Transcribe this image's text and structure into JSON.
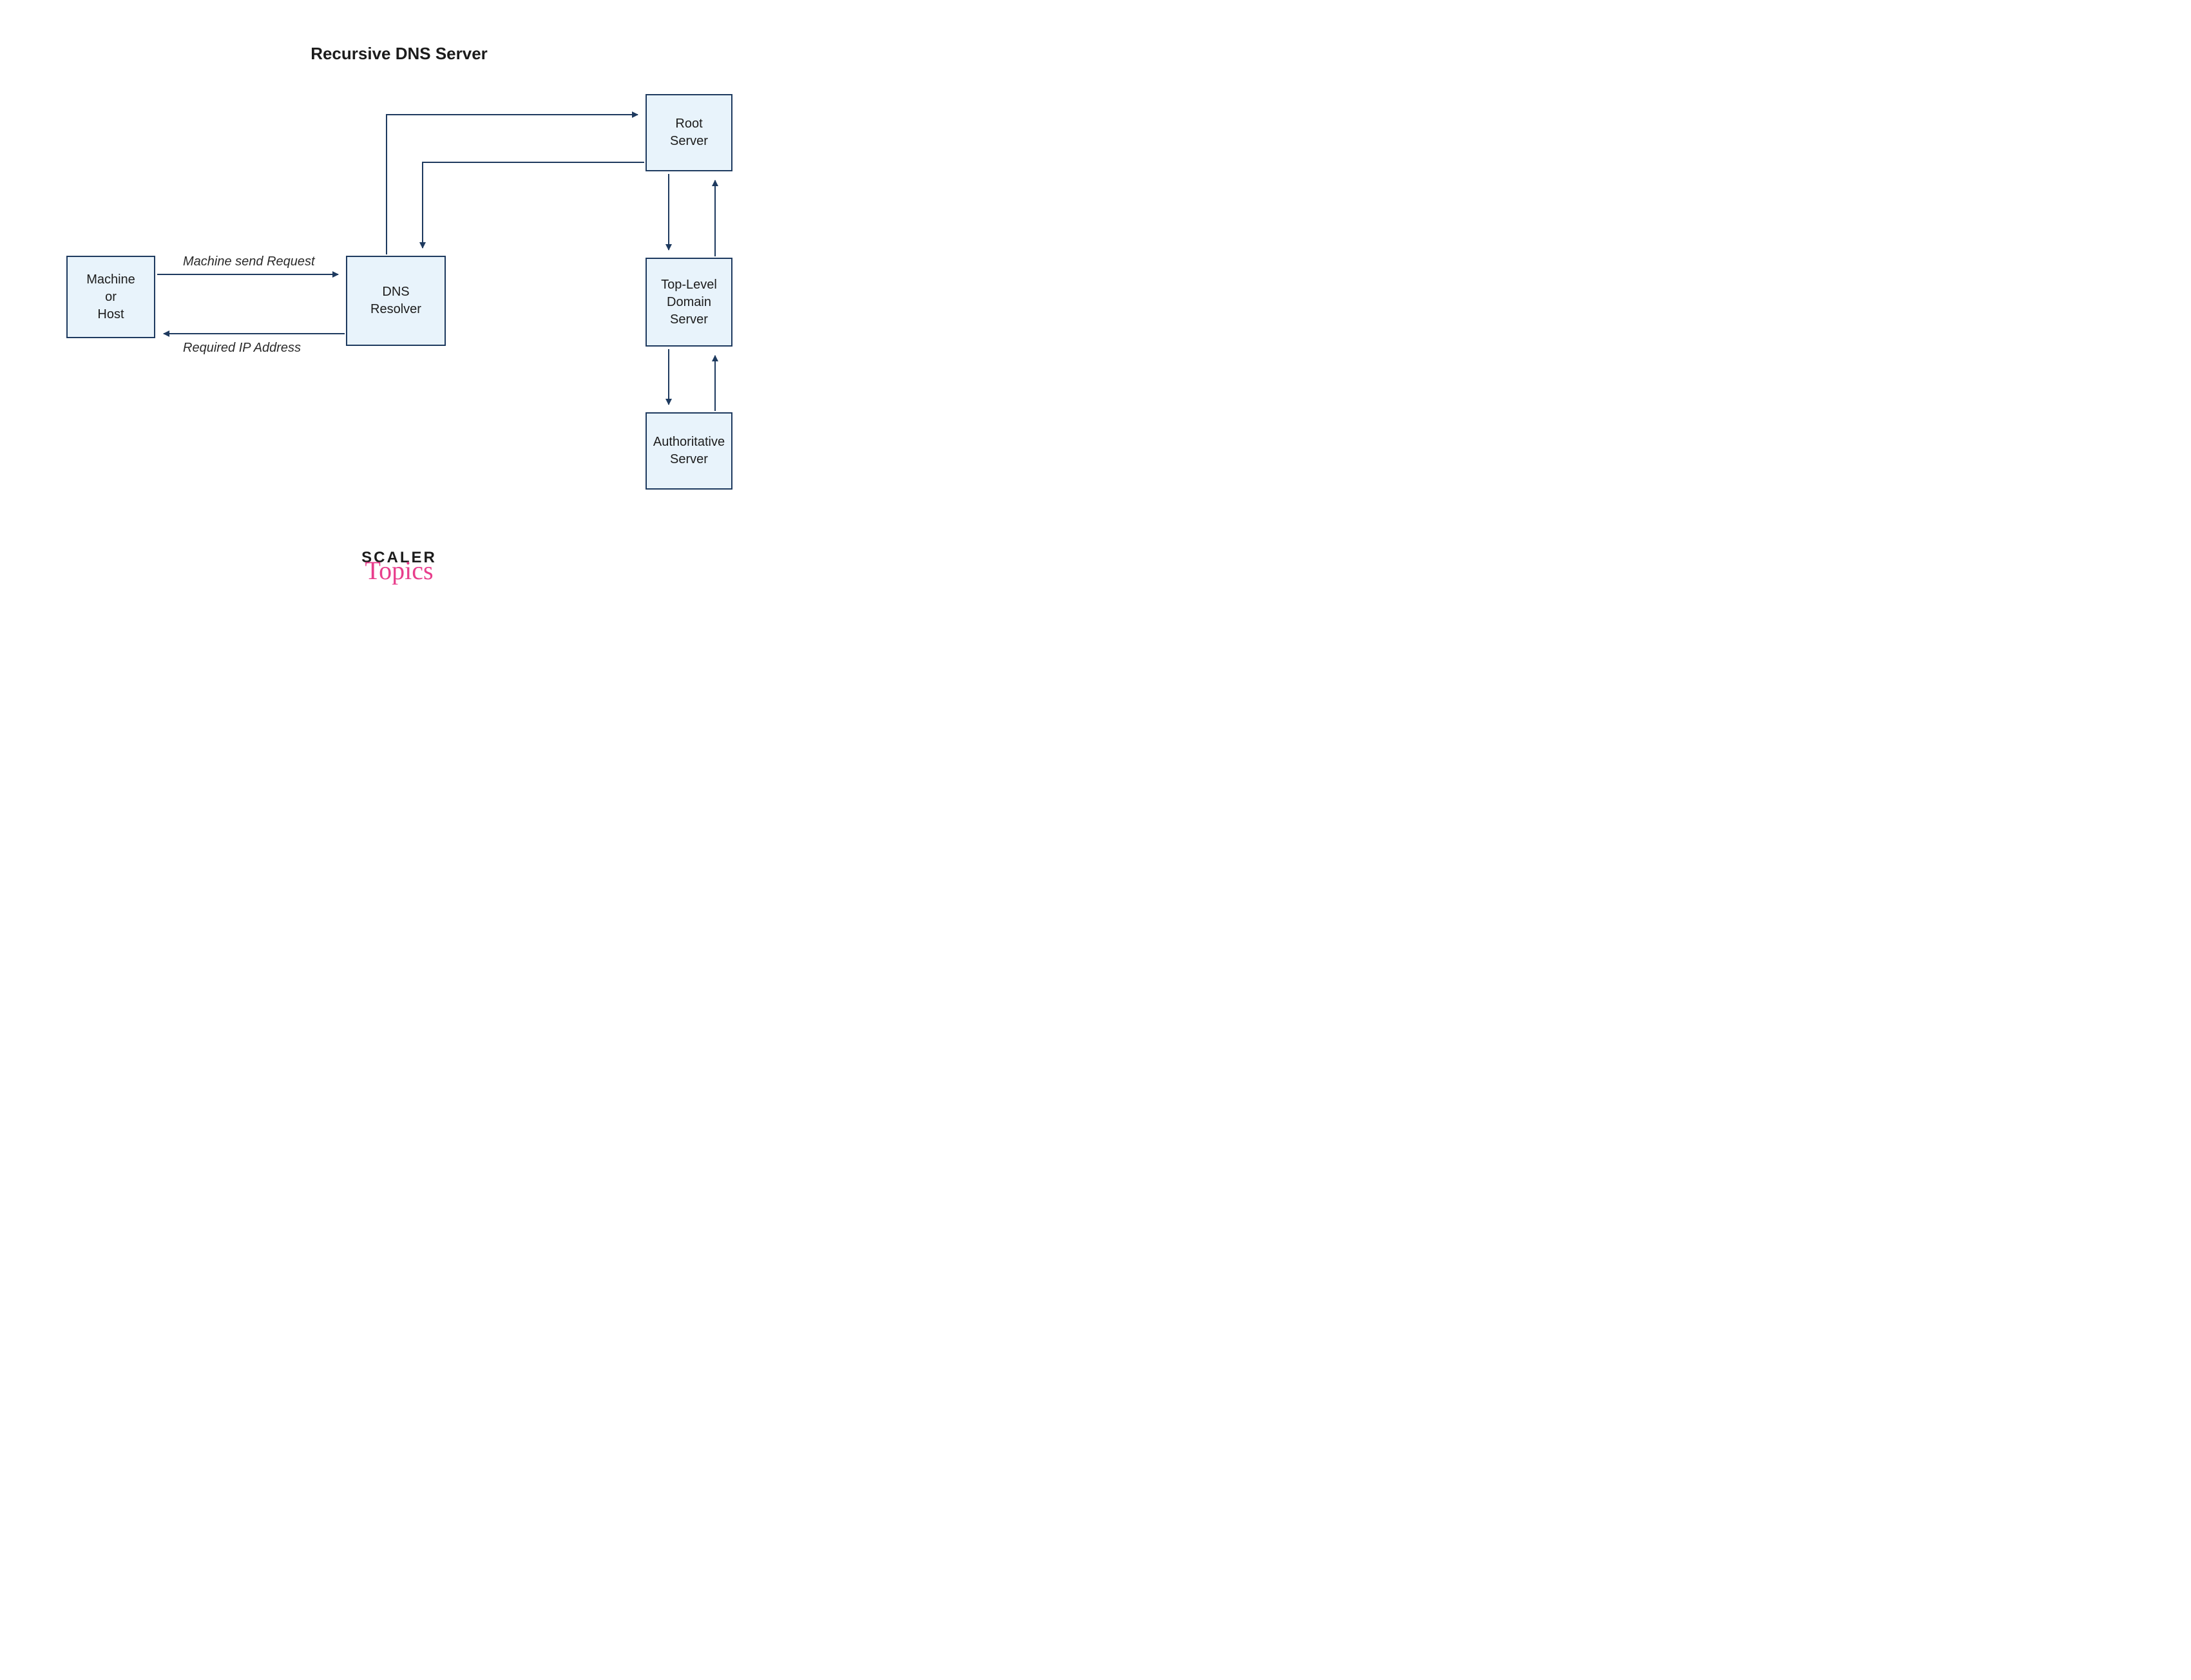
{
  "title": "Recursive DNS Server",
  "nodes": {
    "machine": "Machine\nor\nHost",
    "resolver": "DNS\nResolver",
    "root": "Root\nServer",
    "tld": "Top-Level\nDomain\nServer",
    "auth": "Authoritative\nServer"
  },
  "edges": {
    "request": "Machine send Request",
    "response": "Required IP Address"
  },
  "logo": {
    "line1": "SCALER",
    "line2": "Topics"
  },
  "colors": {
    "nodeFill": "#e8f3fb",
    "nodeStroke": "#1e3a5f",
    "arrow": "#1e3a5f",
    "topicsPink": "#e83e8c"
  }
}
